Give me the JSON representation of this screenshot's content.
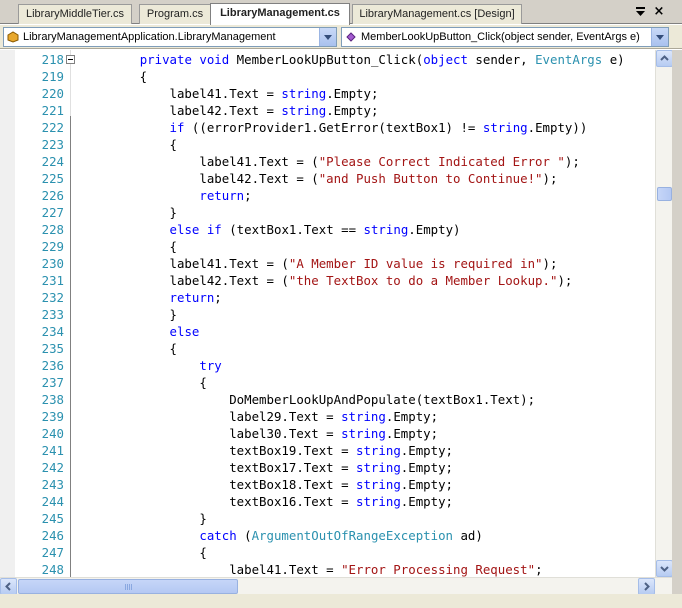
{
  "tabs": [
    {
      "label": "LibraryMiddleTier.cs",
      "active": false
    },
    {
      "label": "Program.cs",
      "active": false
    },
    {
      "label": "LibraryManagement.cs",
      "active": true
    },
    {
      "label": "LibraryManagement.cs [Design]",
      "active": false
    }
  ],
  "window_controls": {
    "pin_icon": "dropdown-arrow-icon",
    "close_label": "×"
  },
  "navbar": {
    "type_combo": {
      "value": "LibraryManagementApplication.LibraryManagement",
      "icon": "class-icon"
    },
    "member_combo": {
      "value": "MemberLookUpButton_Click(object sender, EventArgs e)",
      "icon": "method-icon"
    }
  },
  "colors": {
    "keyword": "#0000ff",
    "type": "#2b91af",
    "string": "#a31515",
    "line_number": "#2b91af"
  },
  "code": {
    "lines": [
      {
        "num": "218",
        "tokens": [
          [
            "",
            "        "
          ],
          [
            "kw",
            "private"
          ],
          [
            "",
            " "
          ],
          [
            "kw",
            "void"
          ],
          [
            "",
            " MemberLookUpButton_Click("
          ],
          [
            "kw",
            "object"
          ],
          [
            "",
            " sender, "
          ],
          [
            "type",
            "EventArgs"
          ],
          [
            "",
            " e)"
          ]
        ]
      },
      {
        "num": "219",
        "tokens": [
          [
            "",
            "        {"
          ]
        ]
      },
      {
        "num": "220",
        "tokens": [
          [
            "",
            "            label41.Text = "
          ],
          [
            "kw",
            "string"
          ],
          [
            "",
            ".Empty;"
          ]
        ]
      },
      {
        "num": "221",
        "tokens": [
          [
            "",
            "            label42.Text = "
          ],
          [
            "kw",
            "string"
          ],
          [
            "",
            ".Empty;"
          ]
        ]
      },
      {
        "num": "222",
        "tokens": [
          [
            "",
            "            "
          ],
          [
            "kw",
            "if"
          ],
          [
            "",
            " ((errorProvider1.GetError(textBox1) != "
          ],
          [
            "kw",
            "string"
          ],
          [
            "",
            ".Empty))"
          ]
        ]
      },
      {
        "num": "223",
        "tokens": [
          [
            "",
            "            {"
          ]
        ]
      },
      {
        "num": "224",
        "tokens": [
          [
            "",
            "                label41.Text = ("
          ],
          [
            "str",
            "\"Please Correct Indicated Error \""
          ],
          [
            "",
            ");"
          ]
        ]
      },
      {
        "num": "225",
        "tokens": [
          [
            "",
            "                label42.Text = ("
          ],
          [
            "str",
            "\"and Push Button to Continue!\""
          ],
          [
            "",
            ");"
          ]
        ]
      },
      {
        "num": "226",
        "tokens": [
          [
            "",
            "                "
          ],
          [
            "kw",
            "return"
          ],
          [
            "",
            ";"
          ]
        ]
      },
      {
        "num": "227",
        "tokens": [
          [
            "",
            "            }"
          ]
        ]
      },
      {
        "num": "228",
        "tokens": [
          [
            "",
            "            "
          ],
          [
            "kw",
            "else"
          ],
          [
            "",
            " "
          ],
          [
            "kw",
            "if"
          ],
          [
            "",
            " (textBox1.Text == "
          ],
          [
            "kw",
            "string"
          ],
          [
            "",
            ".Empty)"
          ]
        ]
      },
      {
        "num": "229",
        "tokens": [
          [
            "",
            "            {"
          ]
        ]
      },
      {
        "num": "230",
        "tokens": [
          [
            "",
            "            label41.Text = ("
          ],
          [
            "str",
            "\"A Member ID value is required in\""
          ],
          [
            "",
            ");"
          ]
        ]
      },
      {
        "num": "231",
        "tokens": [
          [
            "",
            "            label42.Text = ("
          ],
          [
            "str",
            "\"the TextBox to do a Member Lookup.\""
          ],
          [
            "",
            ");"
          ]
        ]
      },
      {
        "num": "232",
        "tokens": [
          [
            "",
            "            "
          ],
          [
            "kw",
            "return"
          ],
          [
            "",
            ";"
          ]
        ]
      },
      {
        "num": "233",
        "tokens": [
          [
            "",
            "            }"
          ]
        ]
      },
      {
        "num": "234",
        "tokens": [
          [
            "",
            "            "
          ],
          [
            "kw",
            "else"
          ]
        ]
      },
      {
        "num": "235",
        "tokens": [
          [
            "",
            "            {"
          ]
        ]
      },
      {
        "num": "236",
        "tokens": [
          [
            "",
            "                "
          ],
          [
            "kw",
            "try"
          ]
        ]
      },
      {
        "num": "237",
        "tokens": [
          [
            "",
            "                {"
          ]
        ]
      },
      {
        "num": "238",
        "tokens": [
          [
            "",
            "                    DoMemberLookUpAndPopulate(textBox1.Text);"
          ]
        ]
      },
      {
        "num": "239",
        "tokens": [
          [
            "",
            "                    label29.Text = "
          ],
          [
            "kw",
            "string"
          ],
          [
            "",
            ".Empty;"
          ]
        ]
      },
      {
        "num": "240",
        "tokens": [
          [
            "",
            "                    label30.Text = "
          ],
          [
            "kw",
            "string"
          ],
          [
            "",
            ".Empty;"
          ]
        ]
      },
      {
        "num": "241",
        "tokens": [
          [
            "",
            "                    textBox19.Text = "
          ],
          [
            "kw",
            "string"
          ],
          [
            "",
            ".Empty;"
          ]
        ]
      },
      {
        "num": "242",
        "tokens": [
          [
            "",
            "                    textBox17.Text = "
          ],
          [
            "kw",
            "string"
          ],
          [
            "",
            ".Empty;"
          ]
        ]
      },
      {
        "num": "243",
        "tokens": [
          [
            "",
            "                    textBox18.Text = "
          ],
          [
            "kw",
            "string"
          ],
          [
            "",
            ".Empty;"
          ]
        ]
      },
      {
        "num": "244",
        "tokens": [
          [
            "",
            "                    textBox16.Text = "
          ],
          [
            "kw",
            "string"
          ],
          [
            "",
            ".Empty;"
          ]
        ]
      },
      {
        "num": "245",
        "tokens": [
          [
            "",
            "                }"
          ]
        ]
      },
      {
        "num": "246",
        "tokens": [
          [
            "",
            "                "
          ],
          [
            "kw",
            "catch"
          ],
          [
            "",
            " ("
          ],
          [
            "type",
            "ArgumentOutOfRangeException"
          ],
          [
            "",
            " ad)"
          ]
        ]
      },
      {
        "num": "247",
        "tokens": [
          [
            "",
            "                {"
          ]
        ]
      },
      {
        "num": "248",
        "tokens": [
          [
            "",
            "                    label41.Text = "
          ],
          [
            "str",
            "\"Error Processing Request\""
          ],
          [
            "",
            ";"
          ]
        ]
      }
    ]
  }
}
